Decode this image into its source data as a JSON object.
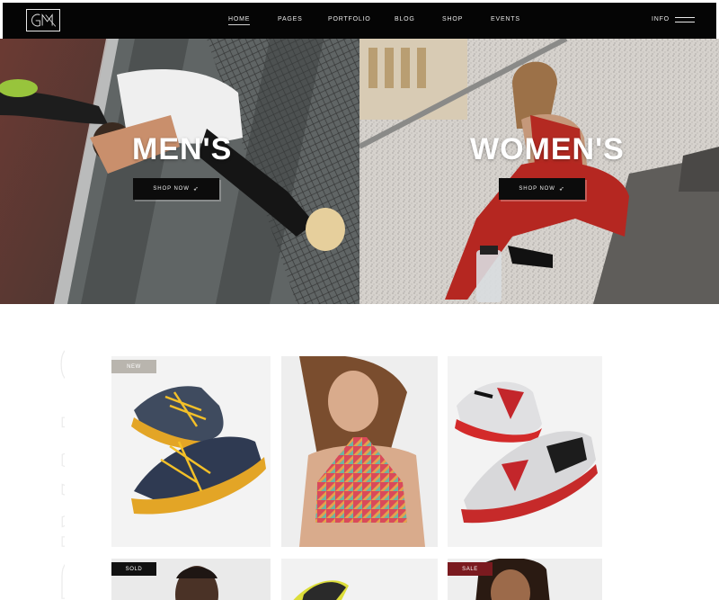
{
  "nav": {
    "items": [
      {
        "label": "HOME",
        "active": true
      },
      {
        "label": "PAGES",
        "active": false
      },
      {
        "label": "PORTFOLIO",
        "active": false
      },
      {
        "label": "BLOG",
        "active": false
      },
      {
        "label": "SHOP",
        "active": false
      },
      {
        "label": "EVENTS",
        "active": false
      }
    ],
    "info_label": "INFO",
    "menu_icon": "hamburger-menu-icon",
    "logo_icon": "gym-logo-icon"
  },
  "hero": {
    "men": {
      "title": "MEN'S",
      "button_label": "SHOP NOW"
    },
    "women": {
      "title": "WOMEN'S",
      "button_label": "SHOP NOW"
    },
    "button_icon": "paper-plane-icon"
  },
  "arrivals": {
    "side_text": "RIVALS",
    "cards": [
      {
        "badge": "NEW",
        "badge_color": "#b9b5ae",
        "image": "blue-yellow-running-shoes"
      },
      {
        "badge": "",
        "badge_color": "",
        "image": "woman-in-geometric-sports-bra"
      },
      {
        "badge": "",
        "badge_color": "",
        "image": "grey-red-sneakers"
      },
      {
        "badge": "SOLD",
        "badge_color": "#111111",
        "image": "man-portrait"
      },
      {
        "badge": "",
        "badge_color": "",
        "image": "yellow-shoe"
      },
      {
        "badge": "SALE",
        "badge_color": "#7a1a1f",
        "image": "woman-portrait"
      }
    ]
  },
  "colors": {
    "nav_bg": "#050505",
    "sale": "#7a1a1f",
    "new": "#b9b5ae"
  }
}
